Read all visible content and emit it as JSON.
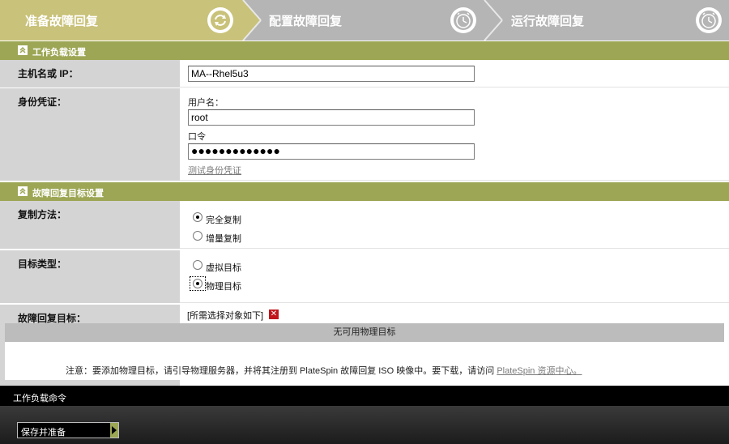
{
  "wizard": {
    "steps": [
      {
        "label": "准备故障回复",
        "icon": "refresh-icon",
        "color": "#c9c27a"
      },
      {
        "label": "配置故障回复",
        "icon": "clock-icon",
        "color": "#b5b5b5"
      },
      {
        "label": "运行故障回复",
        "icon": "clock-icon",
        "color": "#b5b5b5"
      }
    ]
  },
  "workload_section": {
    "title": "工作负载设置",
    "host_label": "主机名或 IP：",
    "host_value": "MA--Rhel5u3",
    "credentials_label": "身份凭证：",
    "username_caption": "用户名：",
    "username_value": "root",
    "password_caption": "口令",
    "password_value": "●●●●●●●●●●●●●",
    "test_credentials_link": "测试身份凭证"
  },
  "target_section": {
    "title": "故障回复目标设置",
    "copy_method_label": "复制方法：",
    "copy_options": [
      "完全复制",
      "增量复制"
    ],
    "copy_selected": "完全复制",
    "target_type_label": "目标类型：",
    "target_type_options": [
      "虚拟目标",
      "物理目标"
    ],
    "target_type_selected": "物理目标",
    "failback_target_label": "故障回复目标：",
    "failback_target_value": "[所需选择对象如下]",
    "error_icon": "x-icon",
    "no_physical_target": "无可用物理目标",
    "note_text": "注意：要添加物理目标，请引导物理服务器，并将其注册到 PlateSpin 故障回复 ISO 映像中。要下载，请访问",
    "note_link": "PlateSpin 资源中心。"
  },
  "commands": {
    "title": "工作负载命令",
    "save_button": "保存并准备"
  },
  "colors": {
    "accent": "#9da654",
    "label_bg": "#d4d4d4",
    "command_bar": "#000000",
    "error": "#c0141c"
  }
}
